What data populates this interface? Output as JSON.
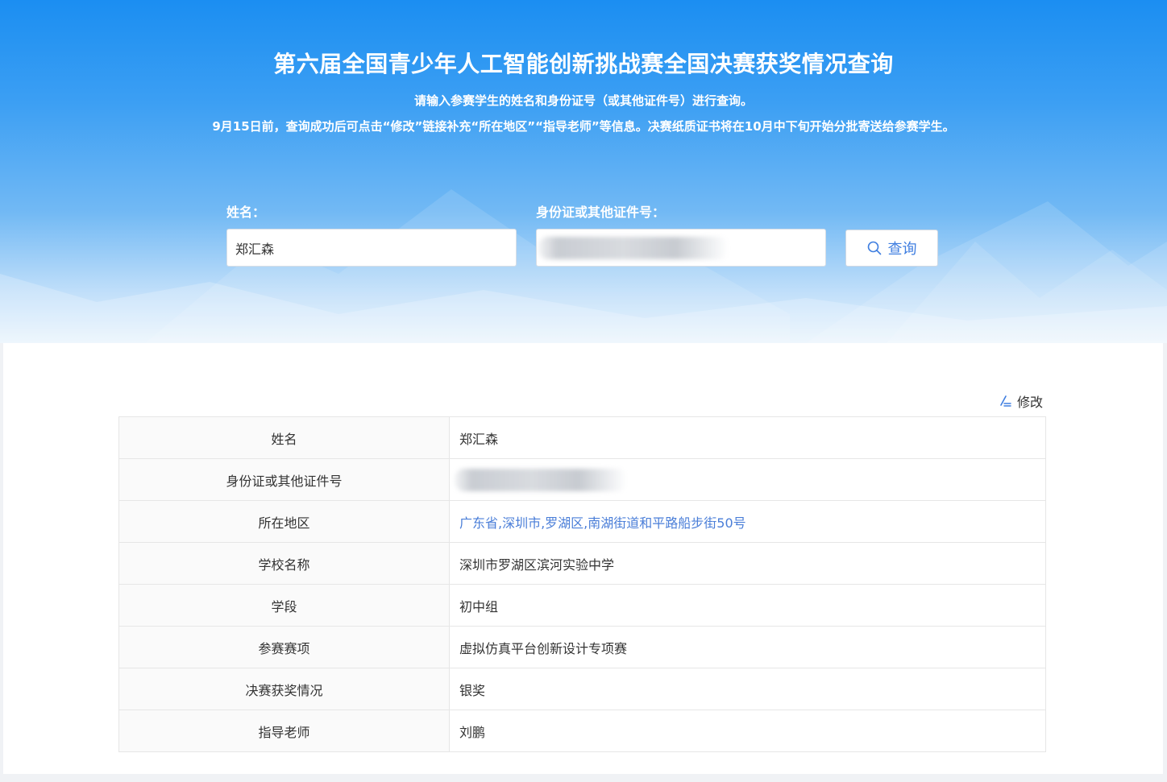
{
  "header": {
    "title": "第六届全国青少年人工智能创新挑战赛全国决赛获奖情况查询",
    "subtitle": "请输入参赛学生的姓名和身份证号（或其他证件号）进行查询。",
    "notice": "9月15日前，查询成功后可点击“修改”链接补充“所在地区”“指导老师”等信息。决赛纸质证书将在10月中下旬开始分批寄送给参赛学生。"
  },
  "search": {
    "name_label": "姓名：",
    "name_value": "郑汇森",
    "id_label": "身份证或其他证件号：",
    "id_value": "",
    "button_label": "查询",
    "button_icon": "search-icon"
  },
  "result": {
    "edit_label": "修改",
    "edit_icon": "edit-icon",
    "rows": [
      {
        "label": "姓名",
        "value": "郑汇森"
      },
      {
        "label": "身份证或其他证件号",
        "value": ""
      },
      {
        "label": "所在地区",
        "value": "广东省,深圳市,罗湖区,南湖街道和平路船步街50号"
      },
      {
        "label": "学校名称",
        "value": "深圳市罗湖区滨河实验中学"
      },
      {
        "label": "学段",
        "value": "初中组"
      },
      {
        "label": "参赛赛项",
        "value": "虚拟仿真平台创新设计专项赛"
      },
      {
        "label": "决赛获奖情况",
        "value": "银奖"
      },
      {
        "label": "指导老师",
        "value": "刘鹏"
      }
    ]
  },
  "colors": {
    "header_blue": "#1b8ef2",
    "link_blue": "#4a7ed8",
    "button_text": "#3f7ee0"
  }
}
